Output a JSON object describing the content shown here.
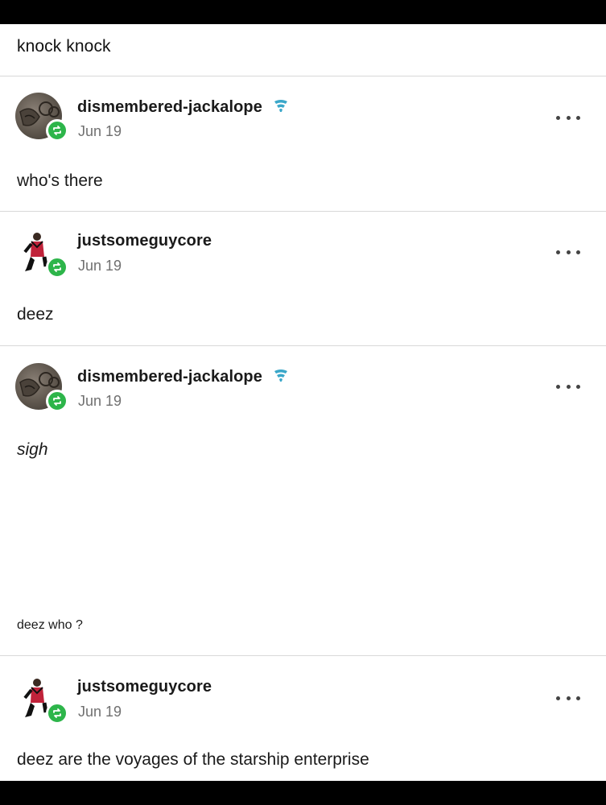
{
  "original_post": {
    "text": "knock knock"
  },
  "posts": [
    {
      "username": "dismembered-jackalope",
      "badge_icon": "cloud-icon",
      "date": "Jun 19",
      "body": "who's there",
      "more_label": "..."
    },
    {
      "username": "justsomeguycore",
      "date": "Jun 19",
      "body": "deez",
      "more_label": "..."
    },
    {
      "username": "dismembered-jackalope",
      "badge_icon": "cloud-icon",
      "date": "Jun 19",
      "body": "sigh",
      "body_small": "deez who ?",
      "more_label": "..."
    },
    {
      "username": "justsomeguycore",
      "date": "Jun 19",
      "body": "deez are the voyages of the starship enterprise",
      "more_label": "..."
    }
  ],
  "colors": {
    "reblog_badge": "#2db54a",
    "date_text": "#707070",
    "divider": "#d8d8d8",
    "cloud_badge": "#3aa7c9"
  }
}
